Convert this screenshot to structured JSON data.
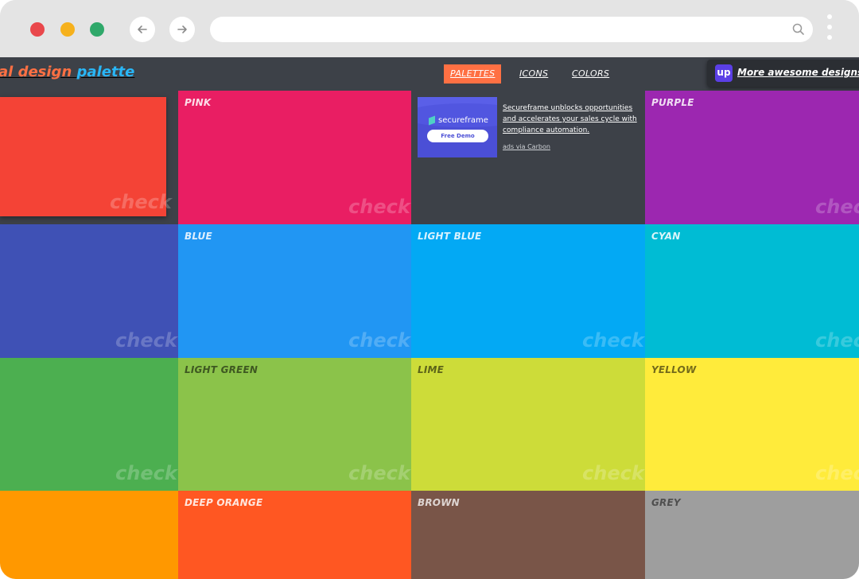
{
  "browser": {
    "address_placeholder": "",
    "icons": [
      "back-arrow-icon",
      "forward-arrow-icon",
      "search-icon",
      "more-vertical-icon"
    ]
  },
  "header": {
    "logo_part1": "al design",
    "logo_part2": "palette",
    "nav": [
      "PALETTES",
      "ICONS",
      "COLORS"
    ],
    "active_nav": "PALETTES",
    "promo_logo": "up",
    "promo_text": "More awesome designs on"
  },
  "colors": {
    "accent": "#ff7043",
    "header_bg": "#3d4148",
    "red": "#f44336",
    "pink": "#e91e63",
    "purple": "#9c27b0",
    "indigo": "#3f51b5",
    "blue": "#2196f3",
    "light_blue": "#03a9f4",
    "cyan": "#00bcd4",
    "green": "#4caf50",
    "light_green": "#8bc34a",
    "lime": "#cddc39",
    "yellow": "#ffeb3b",
    "amber": "#ff9800",
    "deep_orange": "#ff5722",
    "brown": "#795548",
    "grey": "#9e9e9e"
  },
  "tiles": {
    "check": "check",
    "pink": "PINK",
    "purple": "PURPLE",
    "blue": "BLUE",
    "light_blue": "LIGHT BLUE",
    "cyan": "CYAN",
    "light_green": "LIGHT GREEN",
    "lime": "LIME",
    "yellow": "YELLOW",
    "deep_orange": "DEEP ORANGE",
    "brown": "BROWN",
    "grey": "GREY"
  },
  "ad": {
    "brand": "secureframe",
    "button": "Free Demo",
    "text": "Secureframe unblocks opportunities and accelerates your sales cycle with compliance automation.",
    "via": "ads via Carbon"
  }
}
